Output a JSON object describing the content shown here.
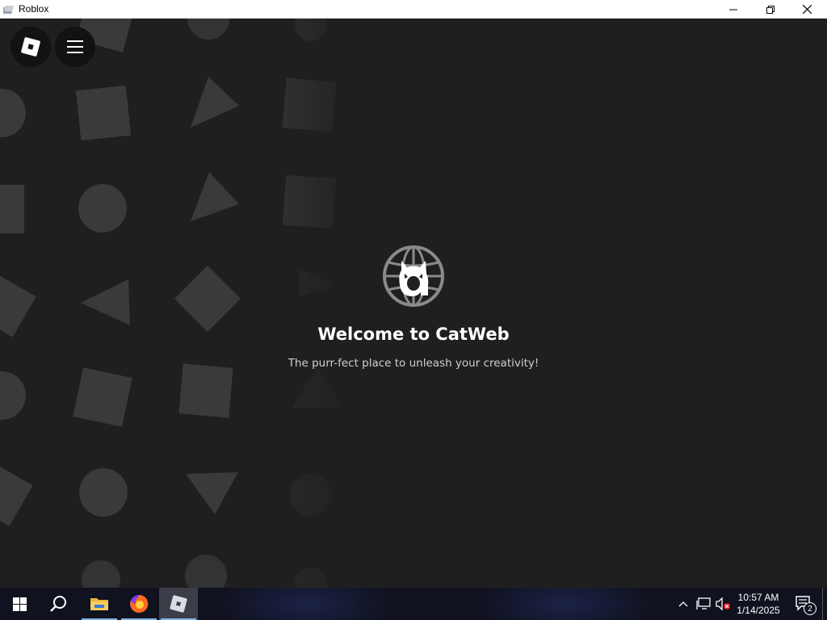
{
  "window": {
    "title": "Roblox",
    "icons": {
      "app": "roblox-icon",
      "minimize": "minimize-icon",
      "restore": "restore-icon",
      "close": "close-icon"
    }
  },
  "game": {
    "menu_buttons": [
      {
        "icon": "roblox-logo-icon"
      },
      {
        "icon": "hamburger-menu-icon"
      }
    ],
    "logo_icon": "catweb-logo-icon",
    "welcome_title": "Welcome to CatWeb",
    "tagline": "The purr-fect place to unleash your creativity!",
    "background_pattern_icons": [
      "square-shape",
      "circle-shape",
      "triangle-shape",
      "hand-print-shape"
    ]
  },
  "taskbar": {
    "apps": [
      {
        "icon": "windows-start-icon"
      },
      {
        "icon": "search-icon"
      },
      {
        "icon": "file-explorer-icon"
      },
      {
        "icon": "firefox-icon"
      },
      {
        "icon": "roblox-icon",
        "active": true
      }
    ],
    "tray": {
      "icons": [
        "chevron-up-icon",
        "network-icon",
        "volume-muted-icon"
      ],
      "time": "10:57 AM",
      "date": "1/14/2025",
      "notification_count": "2"
    }
  },
  "colors": {
    "background": "#1f1f20",
    "pattern_shape": "#3a3a3a",
    "title_text": "#ffffff",
    "tagline_text": "#cfcfcf",
    "taskbar": "#10121f"
  }
}
